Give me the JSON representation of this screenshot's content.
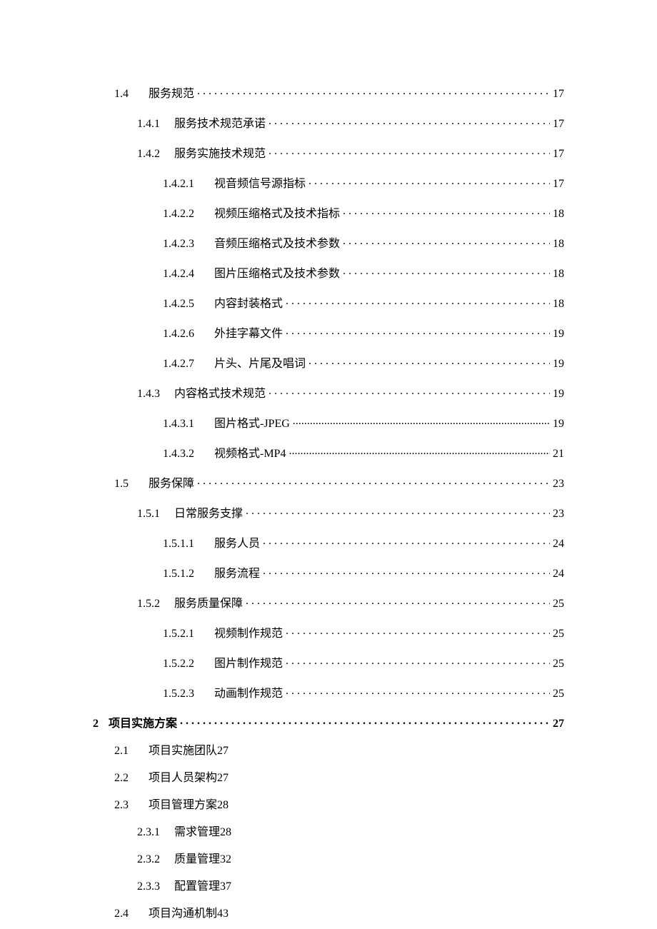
{
  "toc": [
    {
      "level": 2,
      "num": "1.4",
      "title": "服务规范",
      "page": "17",
      "dots": "spaced"
    },
    {
      "level": 3,
      "num": "1.4.1",
      "title": "服务技术规范承诺",
      "page": "17",
      "dots": "spaced"
    },
    {
      "level": 3,
      "num": "1.4.2",
      "title": "服务实施技术规范",
      "page": "17",
      "dots": "spaced"
    },
    {
      "level": 4,
      "num": "1.4.2.1",
      "title": "视音频信号源指标",
      "page": "17",
      "dots": "spaced"
    },
    {
      "level": 4,
      "num": "1.4.2.2",
      "title": "视频压缩格式及技术指标",
      "page": "18",
      "dots": "spaced"
    },
    {
      "level": 4,
      "num": "1.4.2.3",
      "title": "音频压缩格式及技术参数",
      "page": "18",
      "dots": "spaced"
    },
    {
      "level": 4,
      "num": "1.4.2.4",
      "title": "图片压缩格式及技术参数",
      "page": "18",
      "dots": "spaced"
    },
    {
      "level": 4,
      "num": "1.4.2.5",
      "title": "内容封装格式",
      "page": "18",
      "dots": "spaced"
    },
    {
      "level": 4,
      "num": "1.4.2.6",
      "title": "外挂字幕文件",
      "page": "19",
      "dots": "spaced"
    },
    {
      "level": 4,
      "num": "1.4.2.7",
      "title": "片头、片尾及唱词",
      "page": "19",
      "dots": "spaced"
    },
    {
      "level": 3,
      "num": "1.4.3",
      "title": "内容格式技术规范",
      "page": "19",
      "dots": "spaced"
    },
    {
      "level": 4,
      "num": "1.4.3.1",
      "title": "图片格式-JPEG ",
      "page": "19",
      "dots": "dense"
    },
    {
      "level": 4,
      "num": "1.4.3.2",
      "title": "视频格式-MP4 ",
      "page": "21",
      "dots": "dense"
    },
    {
      "level": 2,
      "num": "1.5",
      "title": "服务保障",
      "page": "23",
      "dots": "spaced"
    },
    {
      "level": 3,
      "num": "1.5.1",
      "title": "日常服务支撑",
      "page": "23",
      "dots": "spaced"
    },
    {
      "level": 4,
      "num": "1.5.1.1",
      "title": "服务人员",
      "page": "24",
      "dots": "spaced"
    },
    {
      "level": 4,
      "num": "1.5.1.2",
      "title": "服务流程",
      "page": "24",
      "dots": "spaced"
    },
    {
      "level": 3,
      "num": "1.5.2",
      "title": "服务质量保障",
      "page": "25",
      "dots": "spaced"
    },
    {
      "level": 4,
      "num": "1.5.2.1",
      "title": "视频制作规范",
      "page": "25",
      "dots": "spaced"
    },
    {
      "level": 4,
      "num": "1.5.2.2",
      "title": "图片制作规范",
      "page": "25",
      "dots": "spaced"
    },
    {
      "level": 4,
      "num": "1.5.2.3",
      "title": "动画制作规范",
      "page": "25",
      "dots": "spaced"
    },
    {
      "level": 1,
      "num": "2",
      "title": "项目实施方案",
      "page": "27",
      "dots": "spaced"
    },
    {
      "level": 2,
      "num": "2.1",
      "title": "项目实施团队",
      "page": "27",
      "dots": "none"
    },
    {
      "level": 2,
      "num": "2.2",
      "title": "项目人员架构",
      "page": "27",
      "dots": "none"
    },
    {
      "level": 2,
      "num": "2.3",
      "title": "项目管理方案",
      "page": "28",
      "dots": "none"
    },
    {
      "level": 3,
      "num": "2.3.1",
      "title": "需求管理",
      "page": "28",
      "dots": "none"
    },
    {
      "level": 3,
      "num": "2.3.2",
      "title": "质量管理",
      "page": "32",
      "dots": "none"
    },
    {
      "level": 3,
      "num": "2.3.3",
      "title": "配置管理",
      "page": "37",
      "dots": "none"
    },
    {
      "level": 2,
      "num": "2.4",
      "title": "项目沟通机制",
      "page": "43",
      "dots": "none"
    }
  ]
}
